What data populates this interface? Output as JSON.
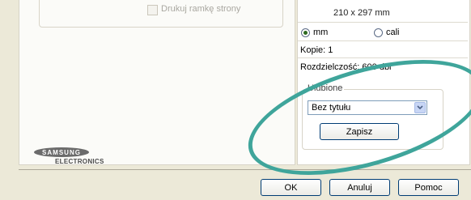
{
  "layout_panel": {
    "print_page_border_label": "Drukuj ramkę strony"
  },
  "info_panel": {
    "paper_size": "210 x 297 mm",
    "unit_mm_label": "mm",
    "unit_inch_label": "cali",
    "selected_unit": "mm",
    "copies": "Kopie: 1",
    "resolution_partial": "Rozdzielczość: 600 dpi"
  },
  "favorites": {
    "legend": "Ulubione",
    "selected": "Bez tytułu",
    "save_label": "Zapisz"
  },
  "branding": {
    "brand": "SAMSUNG",
    "sub": "ELECTRONICS"
  },
  "footer": {
    "ok_label": "OK",
    "cancel_label": "Anuluj",
    "help_label": "Pomoc"
  },
  "annotation": {
    "highlight_color": "#3fa59b"
  }
}
